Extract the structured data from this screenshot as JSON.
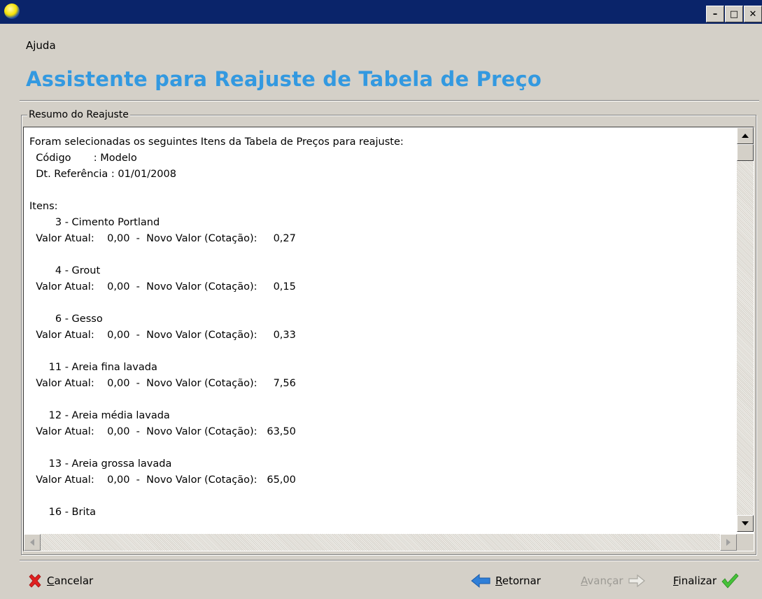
{
  "window": {
    "minimize_glyph": "–",
    "maximize_glyph": "□",
    "close_glyph": "✕"
  },
  "menu": {
    "items": [
      "Ajuda"
    ]
  },
  "heading": "Assistente para Reajuste de Tabela de Preço",
  "group_label": "Resumo do Reajuste",
  "summary_lines": [
    "Foram selecionadas os seguintes Itens da Tabela de Preços para reajuste:",
    "  Código       : Modelo",
    "  Dt. Referência : 01/01/2008",
    "",
    "Itens:",
    "        3 - Cimento Portland",
    "  Valor Atual:    0,00  -  Novo Valor (Cotação):     0,27",
    "",
    "        4 - Grout",
    "  Valor Atual:    0,00  -  Novo Valor (Cotação):     0,15",
    "",
    "        6 - Gesso",
    "  Valor Atual:    0,00  -  Novo Valor (Cotação):     0,33",
    "",
    "      11 - Areia fina lavada",
    "  Valor Atual:    0,00  -  Novo Valor (Cotação):     7,56",
    "",
    "      12 - Areia média lavada",
    "  Valor Atual:    0,00  -  Novo Valor (Cotação):   63,50",
    "",
    "      13 - Areia grossa lavada",
    "  Valor Atual:    0,00  -  Novo Valor (Cotação):   65,00",
    "",
    "      16 - Brita"
  ],
  "buttons": {
    "cancel": {
      "first": "C",
      "rest": "ancelar",
      "icon": "red-x-icon",
      "color": "#e02020"
    },
    "back": {
      "first": "R",
      "rest": "etornar",
      "icon": "blue-left-arrow-icon",
      "color": "#2f7fd8"
    },
    "next": {
      "first": "A",
      "rest": "vançar",
      "icon": "right-arrow-outline-icon",
      "enabled": false
    },
    "finish": {
      "first": "F",
      "rest": "inalizar",
      "icon": "green-check-icon",
      "color": "#46c23a"
    }
  }
}
